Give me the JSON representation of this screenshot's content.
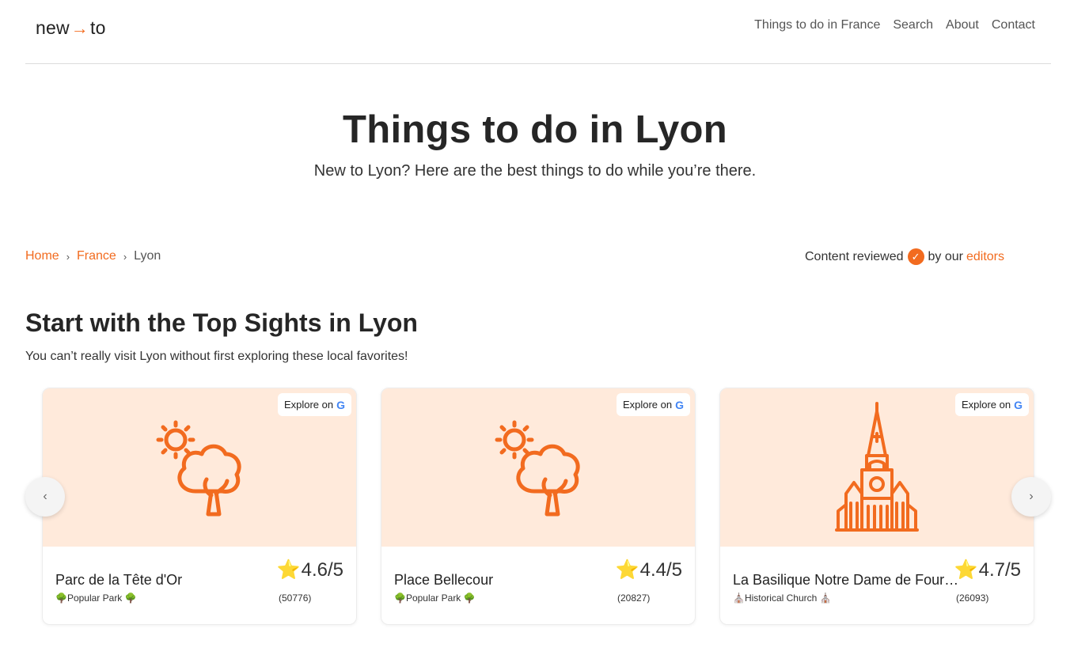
{
  "header": {
    "logo_left": "new",
    "logo_arrow": "→",
    "logo_right": "to",
    "nav": [
      "Things to do in France",
      "Search",
      "About",
      "Contact"
    ]
  },
  "hero": {
    "title": "Things to do in Lyon",
    "subtitle": "New to Lyon? Here are the best things to do while you’re there."
  },
  "breadcrumb": {
    "items": [
      "Home",
      "France",
      "Lyon"
    ],
    "separator": "›"
  },
  "reviewed": {
    "prefix": "Content reviewed",
    "check": "✓",
    "middle": "by our",
    "link": "editors"
  },
  "section": {
    "title": "Start with the Top Sights in Lyon",
    "subtitle": "You can’t really visit Lyon without first exploring these local favorites!"
  },
  "cards": [
    {
      "explore": "Explore on",
      "google": "G",
      "icon": "park-sun-tree-icon",
      "name": "Parc de la Tête d'Or",
      "category": "🌳Popular Park 🌳",
      "star": "⭐",
      "rating": "4.6/5",
      "count": "(50776)"
    },
    {
      "explore": "Explore on",
      "google": "G",
      "icon": "park-sun-tree-icon",
      "name": "Place Bellecour",
      "category": "🌳Popular Park 🌳",
      "star": "⭐",
      "rating": "4.4/5",
      "count": "(20827)"
    },
    {
      "explore": "Explore on",
      "google": "G",
      "icon": "church-icon",
      "name": "La Basilique Notre Dame de Fourvière",
      "category": "⛪Historical Church ⛪",
      "star": "⭐",
      "rating": "4.7/5",
      "count": "(26093)"
    }
  ],
  "carousel": {
    "prev": "‹",
    "next": "›"
  },
  "colors": {
    "accent": "#f26b1f",
    "card_bg": "#ffeadb"
  }
}
